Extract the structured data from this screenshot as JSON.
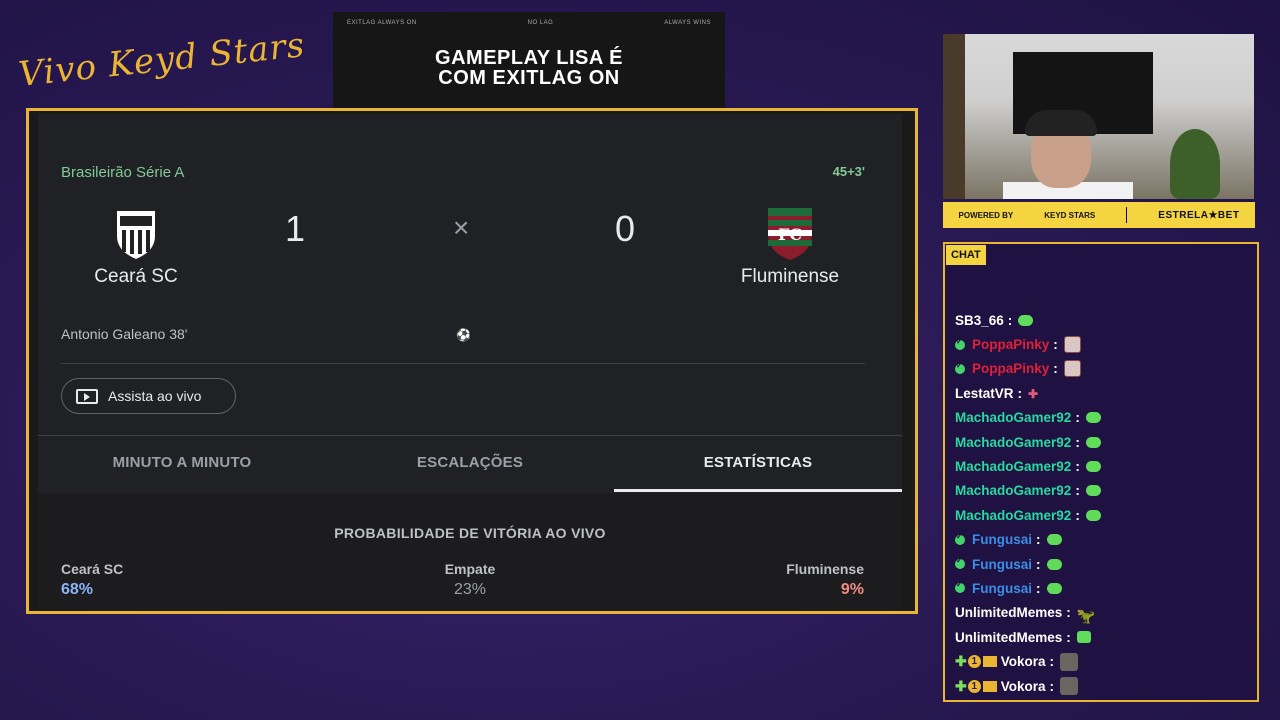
{
  "overlay": {
    "signature": "Vivo Keyd Stars"
  },
  "ad": {
    "top_left": "EXITLAG ALWAYS ON",
    "top_middle": "NO LAG",
    "top_right": "ALWAYS WINS",
    "title_line1": "GAMEPLAY LISA É",
    "title_line2": "COM EXITLAG ON"
  },
  "match": {
    "competition": "Brasileirão Série A",
    "time": "45+3'",
    "home_team": "Ceará SC",
    "away_team": "Fluminense",
    "home_score": "1",
    "away_score": "0",
    "separator": "×",
    "scorer": "Antonio Galeano 38'",
    "watch_label": "Assista ao vivo",
    "tabs": [
      "MINUTO A MINUTO",
      "ESCALAÇÕES",
      "ESTATÍSTICAS"
    ],
    "active_tab": "ESTATÍSTICAS",
    "probability_title": "PROBABILIDADE DE VITÓRIA AO VIVO",
    "probability": {
      "home_label": "Ceará SC",
      "home_value": "68%",
      "draw_label": "Empate",
      "draw_value": "23%",
      "away_label": "Fluminense",
      "away_value": "9%"
    },
    "colors": {
      "home_prob": "#8ab4f8",
      "away_prob": "#f28b82",
      "accent_green": "#81c995"
    }
  },
  "sponsor": {
    "powered_by": "POWERED BY",
    "keyd": "KEYD STARS",
    "bet": "ESTRELA★BET"
  },
  "chat": {
    "label": "CHAT",
    "messages": [
      {
        "user": "SB3_66",
        "color": "#ffffff",
        "check": false,
        "badges": false,
        "emote": "em-green"
      },
      {
        "user": "PoppaPinky",
        "color": "#e0203a",
        "check": true,
        "badges": false,
        "emote": "em-face"
      },
      {
        "user": "PoppaPinky",
        "color": "#e0203a",
        "check": true,
        "badges": false,
        "emote": "em-face"
      },
      {
        "user": "LestatVR",
        "color": "#ffffff",
        "check": false,
        "badges": false,
        "emote": "em-plus"
      },
      {
        "user": "MachadoGamer92",
        "color": "#27d9a0",
        "check": false,
        "badges": false,
        "emote": "em-green"
      },
      {
        "user": "MachadoGamer92",
        "color": "#27d9a0",
        "check": false,
        "badges": false,
        "emote": "em-green"
      },
      {
        "user": "MachadoGamer92",
        "color": "#27d9a0",
        "check": false,
        "badges": false,
        "emote": "em-green"
      },
      {
        "user": "MachadoGamer92",
        "color": "#27d9a0",
        "check": false,
        "badges": false,
        "emote": "em-green"
      },
      {
        "user": "MachadoGamer92",
        "color": "#27d9a0",
        "check": false,
        "badges": false,
        "emote": "em-green"
      },
      {
        "user": "Fungusai",
        "color": "#3a8ee6",
        "check": true,
        "badges": false,
        "emote": "em-green"
      },
      {
        "user": "Fungusai",
        "color": "#3a8ee6",
        "check": true,
        "badges": false,
        "emote": "em-green"
      },
      {
        "user": "Fungusai",
        "color": "#3a8ee6",
        "check": true,
        "badges": false,
        "emote": "em-green"
      },
      {
        "user": "UnlimitedMemes",
        "color": "#ffffff",
        "check": false,
        "badges": false,
        "emote": "em-dino"
      },
      {
        "user": "UnlimitedMemes",
        "color": "#ffffff",
        "check": false,
        "badges": false,
        "emote": "em-box"
      },
      {
        "user": "Vokora",
        "color": "#ffffff",
        "check": false,
        "badges": true,
        "emote": "em-figure"
      },
      {
        "user": "Vokora",
        "color": "#ffffff",
        "check": false,
        "badges": true,
        "emote": "em-figure"
      }
    ]
  }
}
